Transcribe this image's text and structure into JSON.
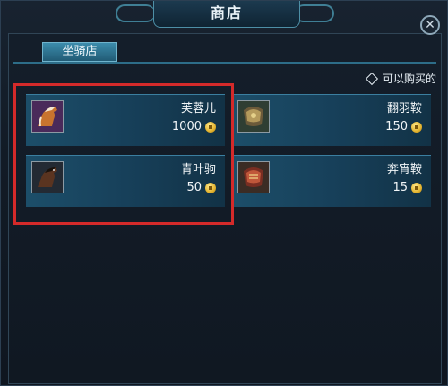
{
  "window": {
    "title": "商店",
    "close_icon": "close-icon"
  },
  "tabs": [
    {
      "label": "坐骑店",
      "active": true
    }
  ],
  "filter": {
    "label": "可以购买的",
    "checked": false
  },
  "items": [
    {
      "name": "芙蓉儿",
      "price": "1000",
      "icon": "horse-chestnut-icon"
    },
    {
      "name": "翻羽鞍",
      "price": "150",
      "icon": "saddle-armor-icon"
    },
    {
      "name": "青叶驹",
      "price": "50",
      "icon": "horse-dark-icon"
    },
    {
      "name": "奔宵鞍",
      "price": "15",
      "icon": "saddle-red-icon"
    }
  ],
  "currency_icon": "coin-icon",
  "colors": {
    "highlight": "#d42a2a",
    "tab": "#3c8cac",
    "coin": "#e3b32e"
  }
}
